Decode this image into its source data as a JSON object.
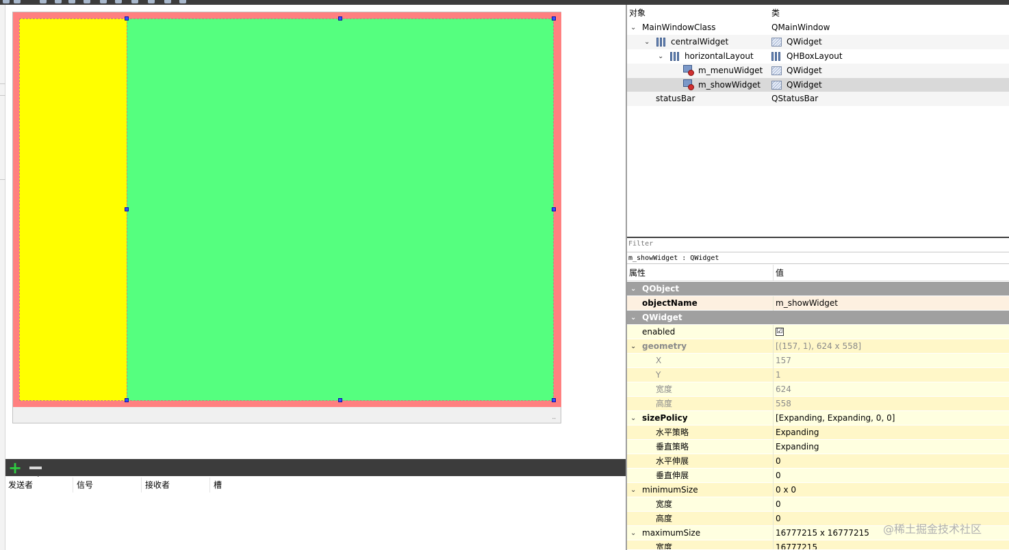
{
  "object_inspector": {
    "col_object": "对象",
    "col_class": "类",
    "rows": [
      {
        "name": "MainWindowClass",
        "class": "QMainWindow"
      },
      {
        "name": "centralWidget",
        "class": "QWidget"
      },
      {
        "name": "horizontalLayout",
        "class": "QHBoxLayout"
      },
      {
        "name": "m_menuWidget",
        "class": "QWidget"
      },
      {
        "name": "m_showWidget",
        "class": "QWidget"
      },
      {
        "name": "statusBar",
        "class": "QStatusBar"
      }
    ]
  },
  "filter": {
    "placeholder": "Filter"
  },
  "current_object": "m_showWidget : QWidget",
  "property_editor": {
    "col_property": "属性",
    "col_value": "值",
    "rows": [
      {
        "name": "QObject",
        "value": ""
      },
      {
        "name": "objectName",
        "value": "m_showWidget"
      },
      {
        "name": "QWidget",
        "value": ""
      },
      {
        "name": "enabled",
        "value": "☑"
      },
      {
        "name": "geometry",
        "value": "[(157, 1), 624 x 558]"
      },
      {
        "name": "X",
        "value": "157"
      },
      {
        "name": "Y",
        "value": "1"
      },
      {
        "name": "宽度",
        "value": "624"
      },
      {
        "name": "高度",
        "value": "558"
      },
      {
        "name": "sizePolicy",
        "value": "[Expanding, Expanding, 0, 0]"
      },
      {
        "name": "水平策略",
        "value": "Expanding"
      },
      {
        "name": "垂直策略",
        "value": "Expanding"
      },
      {
        "name": "水平伸展",
        "value": "0"
      },
      {
        "name": "垂直伸展",
        "value": "0"
      },
      {
        "name": "minimumSize",
        "value": "0 x 0"
      },
      {
        "name": "宽度",
        "value": "0"
      },
      {
        "name": "高度",
        "value": "0"
      },
      {
        "name": "maximumSize",
        "value": "16777215 x 16777215"
      },
      {
        "name": "宽度",
        "value": "16777215"
      }
    ]
  },
  "signal_slot_editor": {
    "columns": [
      "发送者",
      "信号",
      "接收者",
      "槽"
    ]
  },
  "icons": {
    "add": "+",
    "size_grip": "⠤"
  },
  "colors": {
    "central_widget": "#ff8080",
    "menu_widget": "#ffff00",
    "show_widget": "#55ff7f"
  },
  "watermark": "@稀土掘金技术社区"
}
